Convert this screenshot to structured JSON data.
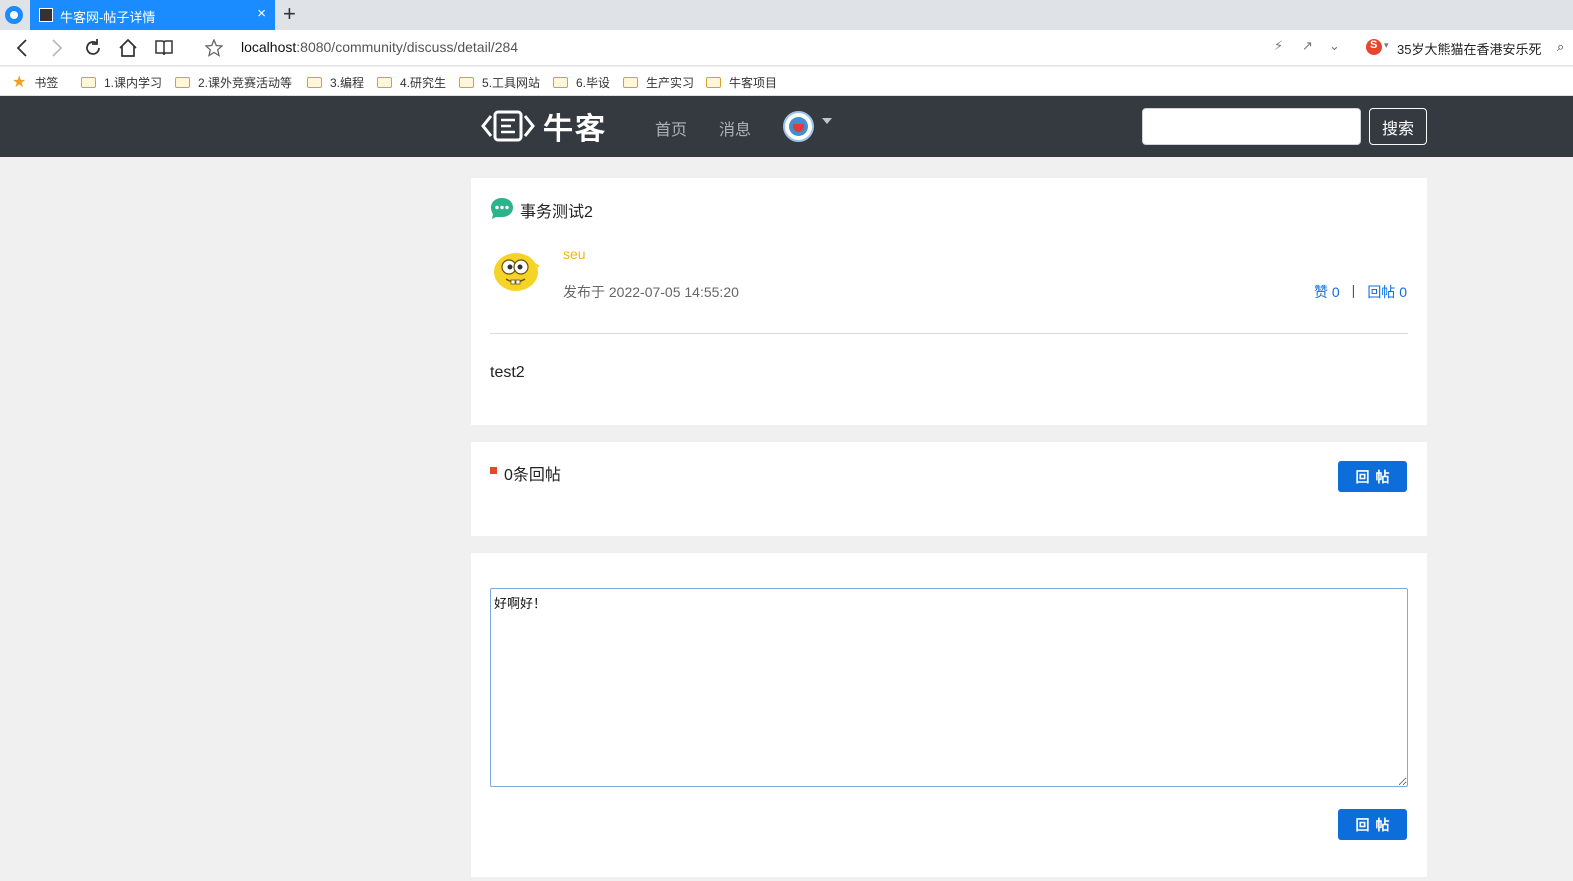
{
  "browser": {
    "tab_title": "牛客网-帖子详情",
    "tab_close": "×",
    "new_tab": "+",
    "url_host": "localhost",
    "url_path": ":8080/community/discuss/detail/284",
    "news_text": "35岁大熊猫在香港安乐死",
    "bookmarks": [
      {
        "label": "书签",
        "icon": "star-icon"
      },
      {
        "label": "1.课内学习",
        "icon": "folder-icon"
      },
      {
        "label": "2.课外竞赛活动等",
        "icon": "folder-icon"
      },
      {
        "label": "3.编程",
        "icon": "folder-icon"
      },
      {
        "label": "4.研究生",
        "icon": "folder-icon"
      },
      {
        "label": "5.工具网站",
        "icon": "folder-icon"
      },
      {
        "label": "6.毕设",
        "icon": "folder-icon"
      },
      {
        "label": "生产实习",
        "icon": "folder-icon"
      },
      {
        "label": "牛客项目",
        "icon": "folder-icon"
      }
    ]
  },
  "header": {
    "logo_text": "牛客",
    "nav": {
      "home": "首页",
      "messages": "消息"
    },
    "search_value": "",
    "search_button": "搜索"
  },
  "post": {
    "title": "事务测试2",
    "author": "seu",
    "time": "发布于 2022-07-05 14:55:20",
    "like_label": "赞 0",
    "reply_label": "回帖 0",
    "separator": "|",
    "content": "test2"
  },
  "replies": {
    "count_label": "0条回帖",
    "reply_button": "回帖"
  },
  "editor": {
    "value": "好啊好！",
    "submit_button": "回帖"
  },
  "colors": {
    "header_bg": "#343a40",
    "accent_blue": "#0d6edb",
    "author_yellow": "#f6b41b",
    "marker_red": "#e8452e",
    "tab_blue": "#1a8cff"
  }
}
